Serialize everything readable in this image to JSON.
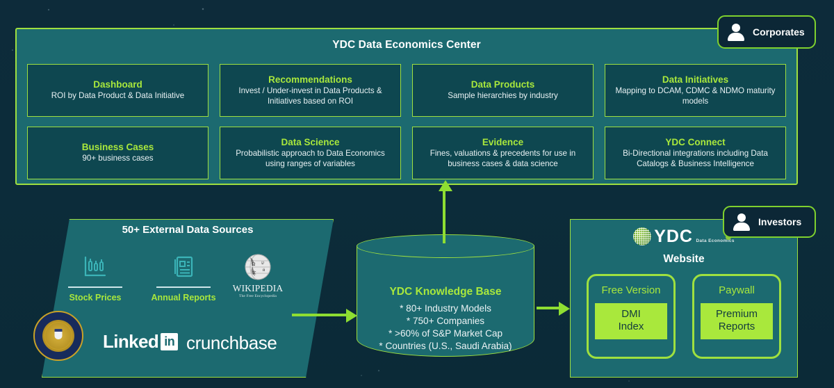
{
  "colors": {
    "background": "#0d2b38",
    "panel": "#1c6a70",
    "card": "#0e4750",
    "accent_green": "#9fe03f",
    "accent_text": "#a9e83c",
    "arrow": "#8ede32",
    "white": "#ffffff"
  },
  "badges": {
    "corporates": {
      "label": "Corporates",
      "icon": "person-icon"
    },
    "investors": {
      "label": "Investors",
      "icon": "person-icon"
    }
  },
  "dec_panel": {
    "title": "YDC Data Economics Center",
    "cards": [
      {
        "title": "Dashboard",
        "desc": "ROI by Data Product & Data Initiative"
      },
      {
        "title": "Recommendations",
        "desc": "Invest / Under-invest in Data Products & Initiatives based on ROI"
      },
      {
        "title": "Data Products",
        "desc": "Sample hierarchies by  industry"
      },
      {
        "title": "Data Initiatives",
        "desc": "Mapping to DCAM, CDMC & NDMO maturity models"
      },
      {
        "title": "Business Cases",
        "desc": "90+ business cases"
      },
      {
        "title": "Data Science",
        "desc": "Probabilistic approach to Data Economics using ranges of variables"
      },
      {
        "title": "Evidence",
        "desc": "Fines, valuations & precedents for use in business cases & data science"
      },
      {
        "title": "YDC Connect",
        "desc": "Bi-Directional integrations including Data Catalogs & Business Intelligence"
      }
    ]
  },
  "sources": {
    "title": "50+ External Data Sources",
    "items": [
      {
        "label": "Stock Prices",
        "icon": "stock-chart-icon"
      },
      {
        "label": "Annual Reports",
        "icon": "document-report-icon"
      }
    ],
    "wikipedia": {
      "name": "WIKIPEDIA",
      "sub": "The Free Encyclopedia",
      "icon": "wikipedia-globe-icon"
    },
    "logos": [
      {
        "name": "sec-seal-logo",
        "label": ""
      },
      {
        "name": "linkedin-logo",
        "label": "Linked",
        "badge": "in"
      },
      {
        "name": "crunchbase-logo",
        "label": "crunchbase"
      }
    ]
  },
  "knowledge_base": {
    "title": "YDC Knowledge Base",
    "bullets": [
      "* 80+ Industry Models",
      "* 750+ Companies",
      "* >60% of S&P Market Cap",
      "* Countries (U.S., Saudi Arabia)"
    ]
  },
  "website": {
    "logo": {
      "letters": "YDC",
      "tagline": "Data Economics",
      "icon": "ydc-sphere-icon"
    },
    "title": "Website",
    "tiers": [
      {
        "label": "Free Version",
        "chip_line1": "DMI",
        "chip_line2": "Index"
      },
      {
        "label": "Paywall",
        "chip_line1": "Premium",
        "chip_line2": "Reports"
      }
    ]
  },
  "arrows": [
    {
      "name": "sources-to-knowledgebase",
      "direction": "right"
    },
    {
      "name": "knowledgebase-to-website",
      "direction": "right"
    },
    {
      "name": "knowledgebase-to-dec-panel",
      "direction": "up"
    }
  ]
}
